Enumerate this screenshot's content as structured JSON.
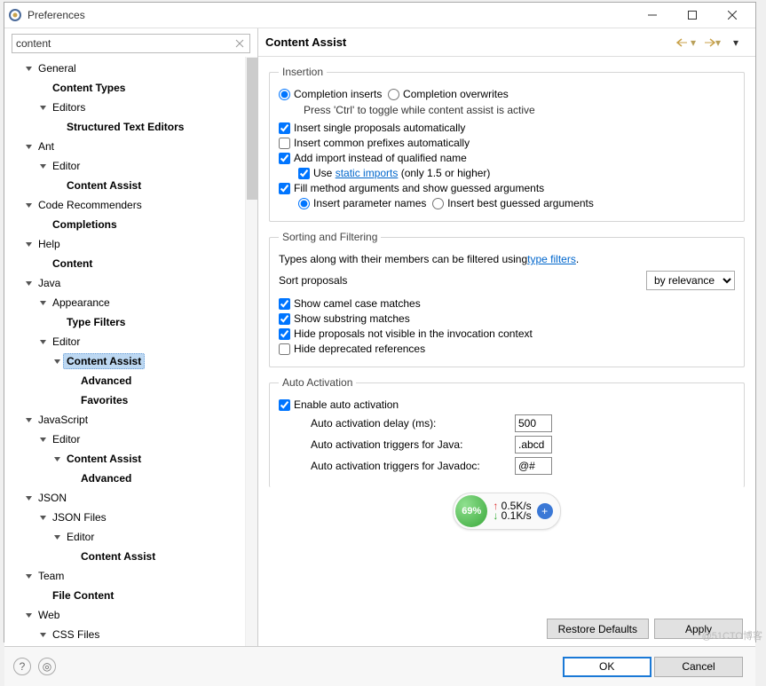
{
  "window": {
    "title": "Preferences"
  },
  "filter": {
    "value": "content"
  },
  "tree": [
    {
      "t": "General",
      "b": false,
      "d": 1,
      "a": "open"
    },
    {
      "t": "Content Types",
      "b": true,
      "d": 2,
      "a": "none"
    },
    {
      "t": "Editors",
      "b": false,
      "d": 2,
      "a": "open"
    },
    {
      "t": "Structured Text Editors",
      "b": true,
      "d": 3,
      "a": "none"
    },
    {
      "t": "Ant",
      "b": false,
      "d": 1,
      "a": "open"
    },
    {
      "t": "Editor",
      "b": false,
      "d": 2,
      "a": "open"
    },
    {
      "t": "Content Assist",
      "b": true,
      "d": 3,
      "a": "none"
    },
    {
      "t": "Code Recommenders",
      "b": false,
      "d": 1,
      "a": "open"
    },
    {
      "t": "Completions",
      "b": true,
      "d": 2,
      "a": "none"
    },
    {
      "t": "Help",
      "b": false,
      "d": 1,
      "a": "open"
    },
    {
      "t": "Content",
      "b": true,
      "d": 2,
      "a": "none"
    },
    {
      "t": "Java",
      "b": false,
      "d": 1,
      "a": "open"
    },
    {
      "t": "Appearance",
      "b": false,
      "d": 2,
      "a": "open"
    },
    {
      "t": "Type Filters",
      "b": true,
      "d": 3,
      "a": "none"
    },
    {
      "t": "Editor",
      "b": false,
      "d": 2,
      "a": "open"
    },
    {
      "t": "Content Assist",
      "b": true,
      "d": 3,
      "a": "open",
      "sel": true
    },
    {
      "t": "Advanced",
      "b": true,
      "d": 4,
      "a": "none"
    },
    {
      "t": "Favorites",
      "b": true,
      "d": 4,
      "a": "none"
    },
    {
      "t": "JavaScript",
      "b": false,
      "d": 1,
      "a": "open"
    },
    {
      "t": "Editor",
      "b": false,
      "d": 2,
      "a": "open"
    },
    {
      "t": "Content Assist",
      "b": true,
      "d": 3,
      "a": "open"
    },
    {
      "t": "Advanced",
      "b": true,
      "d": 4,
      "a": "none"
    },
    {
      "t": "JSON",
      "b": false,
      "d": 1,
      "a": "open"
    },
    {
      "t": "JSON Files",
      "b": false,
      "d": 2,
      "a": "open"
    },
    {
      "t": "Editor",
      "b": false,
      "d": 3,
      "a": "open"
    },
    {
      "t": "Content Assist",
      "b": true,
      "d": 4,
      "a": "none"
    },
    {
      "t": "Team",
      "b": false,
      "d": 1,
      "a": "open"
    },
    {
      "t": "File Content",
      "b": true,
      "d": 2,
      "a": "none"
    },
    {
      "t": "Web",
      "b": false,
      "d": 1,
      "a": "open"
    },
    {
      "t": "CSS Files",
      "b": false,
      "d": 2,
      "a": "open"
    }
  ],
  "page": {
    "title": "Content Assist",
    "insertion": {
      "legend": "Insertion",
      "completion_inserts": "Completion inserts",
      "completion_overwrites": "Completion overwrites",
      "toggle_hint": "Press 'Ctrl' to toggle while content assist is active",
      "single_proposals": "Insert single proposals automatically",
      "common_prefixes": "Insert common prefixes automatically",
      "add_import": "Add import instead of qualified name",
      "use_label": "Use ",
      "static_imports_link": "static imports",
      "use_suffix": " (only 1.5 or higher)",
      "fill_args": "Fill method arguments and show guessed arguments",
      "insert_param_names": "Insert parameter names",
      "insert_best_guessed": "Insert best guessed arguments"
    },
    "sorting": {
      "legend": "Sorting and Filtering",
      "desc_prefix": "Types along with their members can be filtered using ",
      "type_filters_link": "type filters",
      "desc_suffix": ".",
      "sort_label": "Sort proposals",
      "sort_value": "by relevance",
      "camel": "Show camel case matches",
      "substring": "Show substring matches",
      "hide_not_visible": "Hide proposals not visible in the invocation context",
      "hide_deprecated": "Hide deprecated references"
    },
    "auto": {
      "legend": "Auto Activation",
      "enable": "Enable auto activation",
      "delay_label": "Auto activation delay (ms):",
      "delay_value": "500",
      "java_label": "Auto activation triggers for Java:",
      "java_value": ".abcd",
      "javadoc_label": "Auto activation triggers for Javadoc:",
      "javadoc_value": "@#"
    },
    "speed": {
      "percent": "69%",
      "up": "0.5K/s",
      "down": "0.1K/s"
    },
    "buttons": {
      "restore": "Restore Defaults",
      "apply": "Apply",
      "ok": "OK",
      "cancel": "Cancel"
    }
  },
  "watermark": "@51CTO博客"
}
